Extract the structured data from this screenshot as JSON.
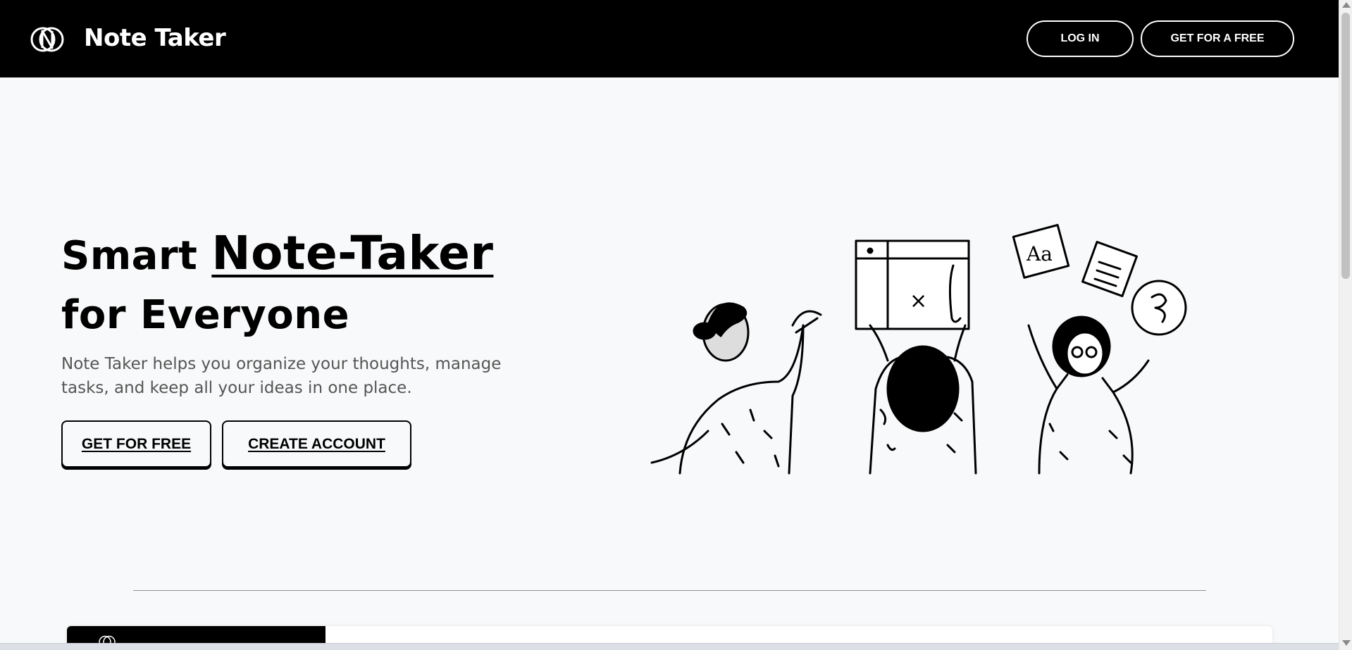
{
  "nav": {
    "brand": "Note Taker",
    "login_label": "LOG IN",
    "get_free_label": "GET FOR A FREE"
  },
  "hero": {
    "title_prefix": "Smart ",
    "title_highlight": "Note-Taker",
    "title_line2": "for Everyone",
    "description": "Note Taker helps you organize your thoughts, manage tasks, and keep all your ideas in one place.",
    "cta_primary": "GET FOR FREE",
    "cta_secondary": "CREATE ACCOUNT"
  },
  "illustration": {
    "board_text": "×",
    "card_text": "Aa"
  },
  "colors": {
    "nav_background": "#000000",
    "page_background": "#f8f9fa",
    "text": "#000000",
    "muted_text": "#555555"
  }
}
